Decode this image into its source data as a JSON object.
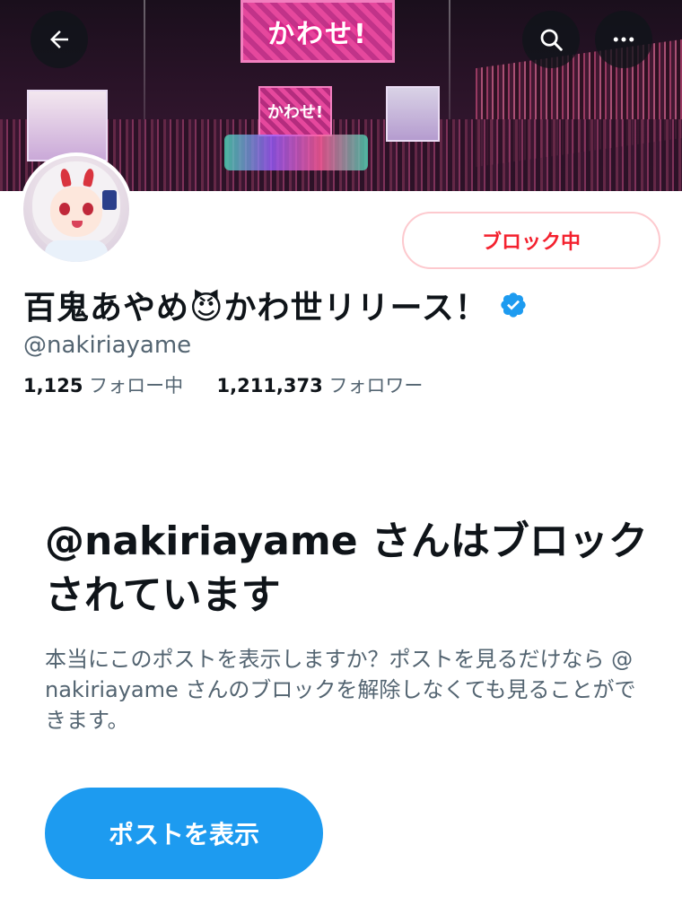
{
  "header": {
    "banner_sign_text": "かわせ!",
    "banner_sub_sign_text": "かわせ!",
    "back_icon": "arrow-left-icon",
    "search_icon": "search-icon",
    "more_icon": "more-horizontal-icon"
  },
  "profile": {
    "display_name": "百鬼あやめ😈かわ世リリース！",
    "handle": "@nakiriayame",
    "verified": true,
    "blocked_button_label": "ブロック中",
    "following_count": "1,125",
    "following_label": "フォロー中",
    "followers_count": "1,211,373",
    "followers_label": "フォロワー"
  },
  "blocked_notice": {
    "title": "@nakiriayame さんはブロックされています",
    "body": "本当にこのポストを表示しますか？ポストを見るだけなら @nakiriayame さんのブロックを解除しなくても見ることができます。",
    "view_button_label": "ポストを表示"
  },
  "colors": {
    "accent_blue": "#1d9bf0",
    "danger_red": "#f4212e",
    "muted_text": "#536471",
    "primary_text": "#0f1419"
  }
}
